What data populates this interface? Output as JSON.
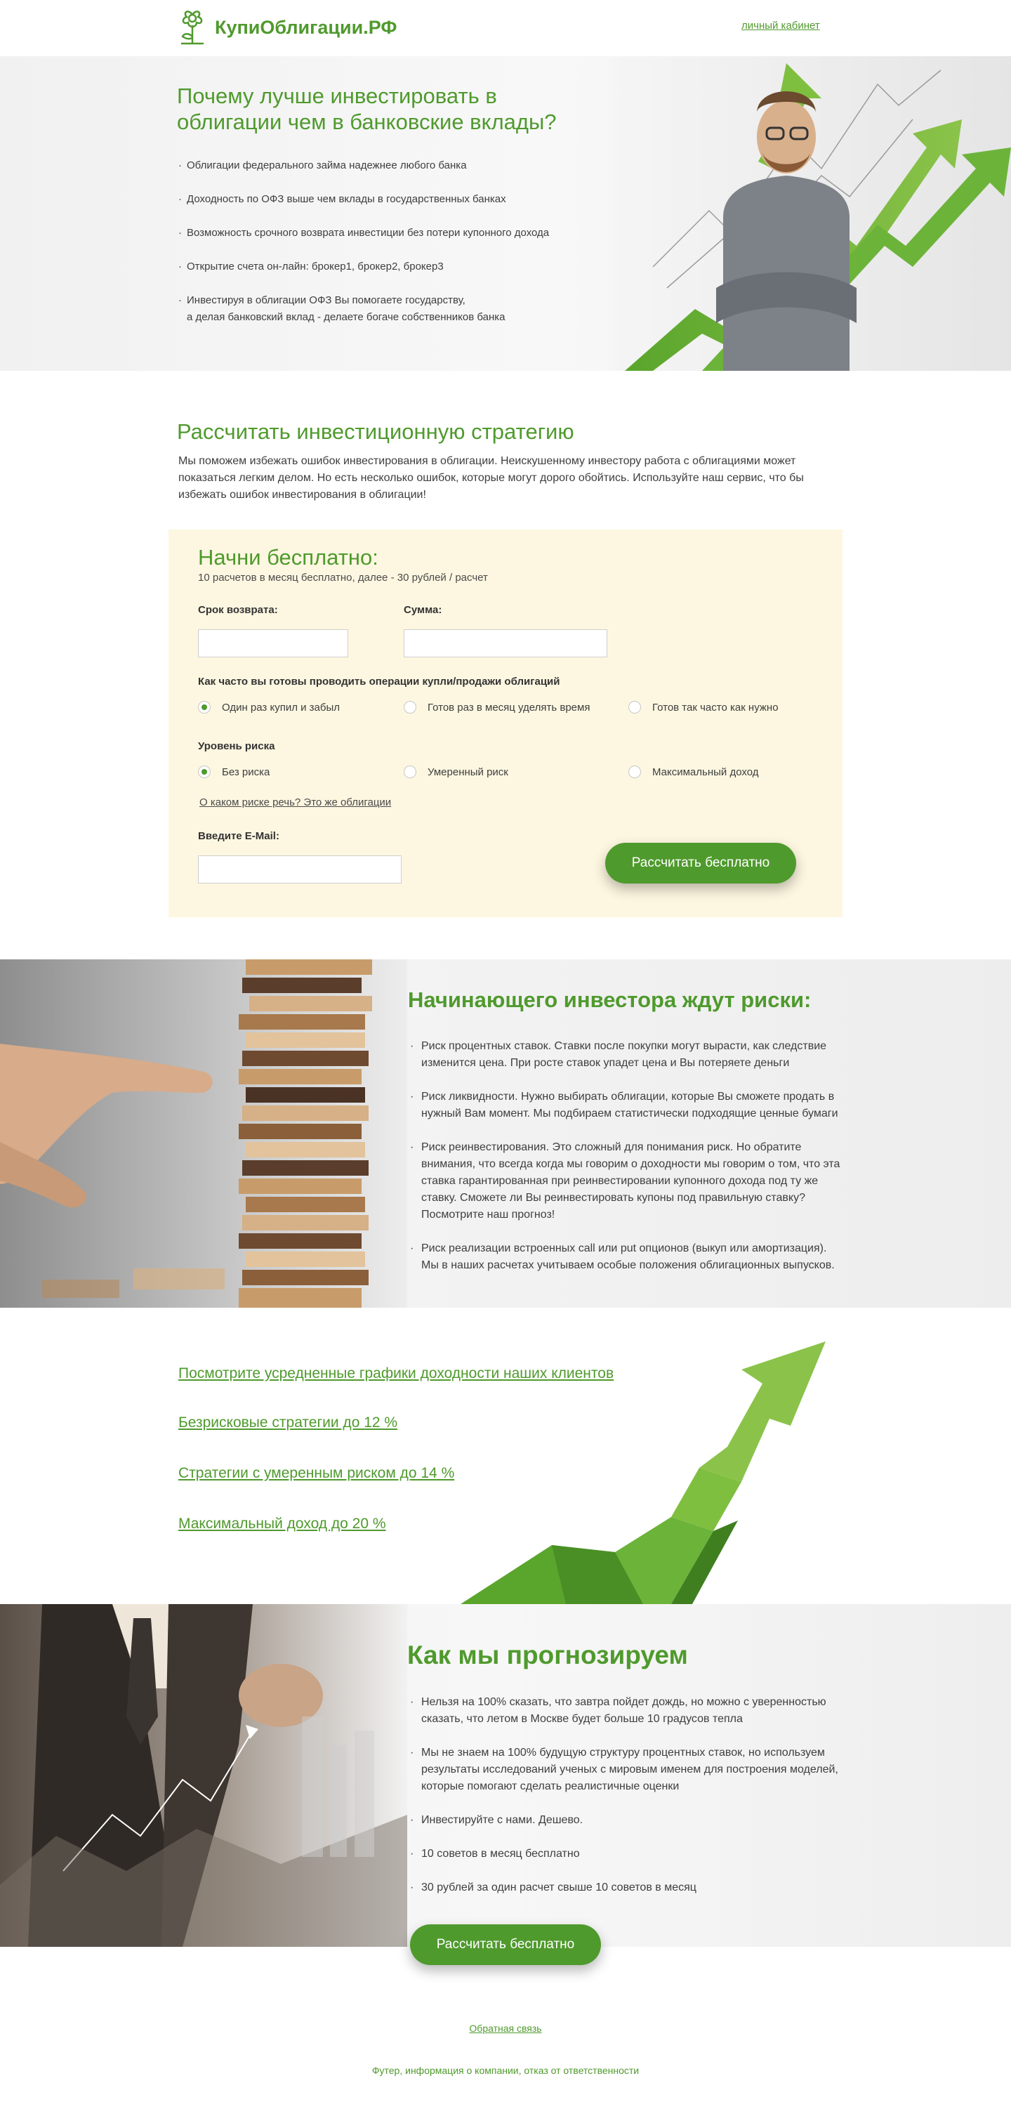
{
  "header": {
    "logo_text": "КупиОблигации.РФ",
    "cabinet_link": "личный кабинет"
  },
  "hero": {
    "title": "Почему лучше инвестировать в облигации чем в банковские вклады?",
    "points": [
      "Облигации федерального займа надежнее любого банка",
      "Доходность по ОФЗ выше чем вклады в государственных банках",
      "Возможность срочного возврата инвестиции без потери купонного дохода",
      "Открытие счета он-лайн: брокер1, брокер2, брокер3",
      "Инвестируя в облигации ОФЗ Вы помогаете государству,\nа делая банковский вклад - делаете богаче собственников банка"
    ]
  },
  "strategy": {
    "title": "Рассчитать инвестиционную стратегию",
    "description": "Мы поможем избежать ошибок инвестирования в облигации. Неискушенному инвестору работа с облигациями может показаться легким делом. Но есть несколько ошибок, которые могут дорого обойтись. Используйте наш сервис, что бы избежать ошибок инвестирования в облигации!"
  },
  "form": {
    "title": "Начни бесплатно:",
    "subtitle": "10 расчетов в месяц бесплатно, далее - 30 рублей / расчет",
    "term_label": "Срок возврата:",
    "term_value": "",
    "sum_label": "Сумма:",
    "sum_value": "",
    "frequency_label": "Как часто вы готовы проводить операции купли/продажи облигаций",
    "frequency_options": [
      "Один раз купил и забыл",
      "Готов раз в месяц уделять время",
      "Готов так часто как нужно"
    ],
    "frequency_selected": 0,
    "risk_label": "Уровень риска",
    "risk_options": [
      "Без риска",
      "Умеренный риск",
      "Максимальный доход"
    ],
    "risk_selected": 0,
    "risk_link": "О каком риске речь? Это же облигации",
    "email_label": "Введите E-Mail:",
    "email_value": "",
    "submit_label": "Рассчитать бесплатно"
  },
  "risks": {
    "title": "Начинающего инвестора ждут риски:",
    "items": [
      "Риск процентных ставок. Ставки после покупки могут вырасти, как следствие изменится цена. При росте ставок упадет цена и Вы потеряете деньги",
      "Риск ликвидности. Нужно выбирать облигации, которые Вы сможете продать в нужный Вам момент. Мы подбираем статистически подходящие ценные бумаги",
      "Риск реинвестирования. Это сложный для понимания риск. Но обратите внимания, что всегда когда мы говорим о доходности мы говорим о том, что эта ставка гарантированная при реинвестировании купонного дохода под ту же ставку. Сможете ли Вы реинвестировать купоны под правильную ставку? Посмотрите наш прогноз!",
      "Риск реализации встроенных call или put опционов (выкуп или амортизация). Мы в наших расчетах учитываем особые положения облигационных выпусков."
    ]
  },
  "links": [
    "Посмотрите усредненные графики доходности наших клиентов",
    "Безрисковые стратегии до 12 %",
    "Стратегии с умеренным риском до 14 %",
    "Максимальный доход до 20 %"
  ],
  "forecast": {
    "title": "Как мы прогнозируем",
    "items": [
      "Нельзя на 100% сказать, что завтра пойдет дождь, но можно с уверенностью сказать, что летом в Москве будет больше 10 градусов тепла",
      "Мы не знаем на 100% будущую структуру процентных ставок, но используем результаты исследований ученых с мировым именем для построения моделей, которые помогают сделать реалистичные оценки",
      "Инвестируйте с нами. Дешево.",
      "10 советов в месяц бесплатно",
      "30 рублей за один расчет свыше 10 советов в месяц"
    ],
    "button_label": "Рассчитать бесплатно"
  },
  "footer": {
    "feedback_link": "Обратная связь",
    "info": "Футер, информация о компании, отказ от ответственности"
  },
  "colors": {
    "accent": "#4f9a2d",
    "form_bg": "#fdf7e1"
  }
}
